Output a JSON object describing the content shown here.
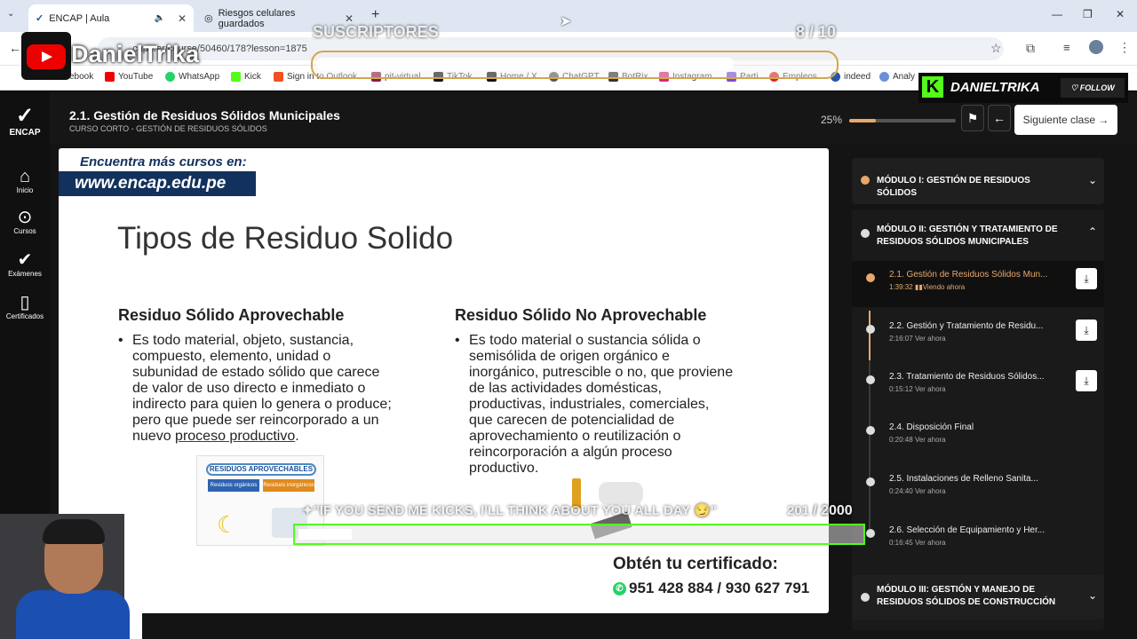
{
  "browser": {
    "tabs": [
      {
        "label": "ENCAP | Aula",
        "close": "✕"
      },
      {
        "label": "Riesgos celulares guardados",
        "close": "✕"
      }
    ],
    "new_tab": "+",
    "url": "...cap...er/course/50460/178?lesson=1875",
    "bookmarks": [
      "ebook",
      "YouTube",
      "WhatsApp",
      "Kick",
      "Sign in to Outlook",
      "pit-virtual",
      "TikTok",
      "Home / X",
      "ChatGPT",
      "BotRix",
      "Instagram",
      "Parti",
      "Empleos",
      "indeed",
      "Analy"
    ],
    "colors": {
      "active_tab": "#ffffff",
      "tab_strip": "#dfe6f2"
    }
  },
  "app": {
    "logo": "ENCAP",
    "nav": [
      {
        "label": "Inicio",
        "icon": "home-icon"
      },
      {
        "label": "Cursos",
        "icon": "play-circle-icon"
      },
      {
        "label": "Exámenes",
        "icon": "check-icon"
      },
      {
        "label": "Certificados",
        "icon": "bookmark-icon"
      }
    ],
    "header": {
      "title": "2.1. Gestión de Residuos Sólidos Municipales",
      "subtitle": "CURSO CORTO - GESTIÓN DE RESIDUOS SÓLIDOS",
      "progress_label": "25%",
      "progress": 0.25,
      "next_button": "Siguiente clase →"
    },
    "accent": "#e8a86b"
  },
  "slide": {
    "promo_line1": "Encuentra más cursos en:",
    "promo_line2": "www.encap.edu.pe",
    "title": "Tipos de Residuo Solido",
    "col1_heading": "Residuo Sólido Aprovechable",
    "col1_lines": [
      "Es todo material, objeto, sustancia,",
      "compuesto, elemento, unidad o",
      "subunidad de estado sólido que carece",
      "de valor de uso directo e inmediato o",
      "indirecto para quien lo genera o produce;",
      "pero que puede ser reincorporado a un"
    ],
    "col1_last_pre": "nuevo ",
    "col1_last_ul": "proceso productivo",
    "col1_last_post": ".",
    "col2_heading": "Residuo Sólido No Aprovechable",
    "col2_lines": [
      "Es todo material o sustancia sólida o",
      "semisólida de origen orgánico    e",
      "inorgánico, putrescible o no, que proviene",
      "de las actividades domésticas,",
      "productivas, industriales, comerciales,",
      "que carecen de potencialidad de",
      "aprovechamiento o reutilización o",
      "reincorporación a algún proceso",
      "productivo."
    ],
    "res_header": "RESIDUOS APROVECHABLES",
    "res_tag1": "Residuos orgánicos",
    "res_tag2": "Residuos inorgánicos",
    "cert": "Obtén tu certificado:",
    "phones": "951 428 884 / 930 627 791"
  },
  "sidebar": {
    "modules": [
      {
        "title": "MÓDULO I: GESTIÓN DE RESIDUOS SÓLIDOS"
      },
      {
        "title": "MÓDULO II: GESTIÓN Y TRATAMIENTO DE RESIDUOS SÓLIDOS MUNICIPALES"
      },
      {
        "title": "MÓDULO III: GESTIÓN Y MANEJO DE RESIDUOS SÓLIDOS DE CONSTRUCCIÓN"
      }
    ],
    "lessons": [
      {
        "name": "2.1. Gestión de Residuos Sólidos Mun...",
        "time": "1:39:32",
        "status": "Viendo ahora"
      },
      {
        "name": "2.2. Gestión y Tratamiento de Residu...",
        "time": "2:16:07",
        "status": "Ver ahora"
      },
      {
        "name": "2.3. Tratamiento de Residuos Sólidos...",
        "time": "0:15:12",
        "status": "Ver ahora"
      },
      {
        "name": "2.4. Disposición Final",
        "time": "0:20:48",
        "status": "Ver ahora"
      },
      {
        "name": "2.5. Instalaciones de Relleno Sanita...",
        "time": "0:24:40",
        "status": "Ver ahora"
      },
      {
        "name": "2.6. Selección de Equipamiento y Her...",
        "time": "0:16:45",
        "status": "Ver ahora"
      }
    ]
  },
  "overlays": {
    "yt_name": "DanielTrika",
    "subs_label": "SUSCRIPTORES",
    "subs_count": "8 / 10",
    "kick_name": "DANIELTRIKA",
    "follow": "FOLLOW",
    "kick_message": "\"IF YOU SEND ME KICKS, I'LL THINK ABOUT YOU ALL DAY 😏\"",
    "kick_current": "201",
    "kick_goal": "/ 2000",
    "kick_color": "#53fc18"
  }
}
